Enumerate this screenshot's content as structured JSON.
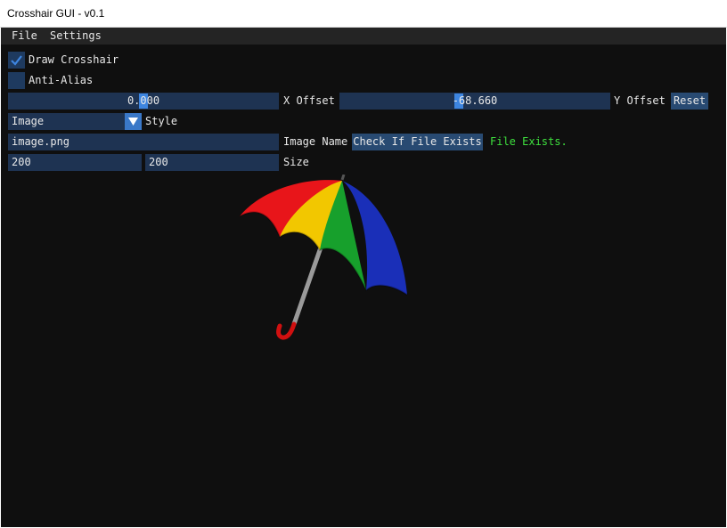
{
  "window": {
    "title": "Crosshair GUI - v0.1"
  },
  "menu": {
    "file": "File",
    "settings": "Settings"
  },
  "draw_crosshair": {
    "label": "Draw Crosshair",
    "checked": true
  },
  "anti_alias": {
    "label": "Anti-Alias",
    "checked": false
  },
  "x_offset": {
    "value": "0.000",
    "label": "X Offset"
  },
  "y_offset": {
    "value": "-68.660",
    "label": "Y Offset"
  },
  "reset_button": "Reset",
  "style": {
    "selected": "Image",
    "label": "Style"
  },
  "image_name": {
    "value": "image.png",
    "label": "Image Name"
  },
  "check_button": "Check If File Exists",
  "file_status": "File Exists.",
  "size": {
    "width": "200",
    "height": "200",
    "label": "Size"
  },
  "colors": {
    "accent": "#3d85e0",
    "frame": "#1e3352",
    "button": "#284a72",
    "status_ok": "#3ee03e",
    "background": "#0f0f0f"
  },
  "preview_image": {
    "icon": "umbrella-icon"
  }
}
